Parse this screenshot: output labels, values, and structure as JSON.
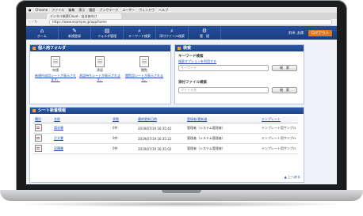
{
  "menubar": [
    "Chrome",
    "ファイル",
    "編集",
    "表示",
    "履歴",
    "ブックマーク",
    "ユーザー",
    "ウィンドウ",
    "ヘルプ"
  ],
  "browser": {
    "tab_title": "デジタル帳票Cloud - 自治体向け",
    "url": "https://www.example.jp/app/home"
  },
  "nav": {
    "items": [
      {
        "label": "ホーム",
        "icon": "home-icon",
        "glyph": "⌂"
      },
      {
        "label": "新規登録",
        "icon": "new-doc-icon",
        "glyph": "✎"
      },
      {
        "label": "フォルダ管理",
        "icon": "folder-icon",
        "glyph": "▤"
      },
      {
        "label": "キーワード検索",
        "icon": "search-icon",
        "glyph": "⌕"
      },
      {
        "label": "添付ファイル検索",
        "icon": "attachment-search-icon",
        "glyph": "⌕"
      },
      {
        "label": "管　理",
        "icon": "gear-icon",
        "glyph": "⚙"
      }
    ],
    "user_name": "鈴木 太郎",
    "logout_label": "ログアウト"
  },
  "personal": {
    "title": "個人用フォルダ",
    "folders": [
      {
        "name": "申請",
        "link": "新規作成用シートが表示されます。"
      },
      {
        "name": "承認",
        "link": "承認待ちシートが表示されます。"
      },
      {
        "name": "閲覧",
        "link": "閲覧用シートが表示されます。"
      }
    ]
  },
  "search": {
    "title": "検索",
    "keyword_label": "キーワード検索",
    "keyword_option_link": "検索オプションを利用する",
    "keyword_placeholder": "キーワード",
    "keyword_button": "検　索",
    "file_label": "添付ファイル検索",
    "file_placeholder": "ファイル名",
    "file_button": "検　索"
  },
  "sheets": {
    "title": "シート新着情報",
    "columns": [
      "種別",
      "名前",
      "状態",
      "最終更新日時",
      "登録者/更新者",
      "テンプレート"
    ],
    "rows": [
      {
        "name": "請求書",
        "status": "0件",
        "updated": "2019/07/19 16:35:42",
        "user": "管理者（システム管理者）",
        "template": "テンプレート用サンプル"
      },
      {
        "name": "注文書",
        "status": "0件",
        "updated": "2019/07/19 16:35:22",
        "user": "管理者（システム管理者）",
        "template": "テンプレート用サンプル"
      },
      {
        "name": "見積書",
        "status": "0件",
        "updated": "2019/07/19 16:35:02",
        "user": "管理者（システム管理者）",
        "template": "テンプレート用サンプル"
      }
    ],
    "to_top": "▲ 上へ戻る"
  }
}
